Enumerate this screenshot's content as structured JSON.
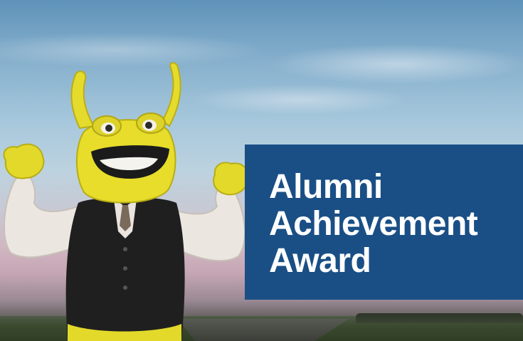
{
  "banner": {
    "lines": [
      "Alumni",
      "Achievement",
      "Award"
    ],
    "background_color": "#1a4f86",
    "text_color": "#ffffff"
  },
  "photo": {
    "subject": "banana-slug-mascot",
    "mascot_color": "#e7dd2a",
    "vest_color": "#1f1f1f",
    "sleeve_color": "#e9e4df"
  }
}
